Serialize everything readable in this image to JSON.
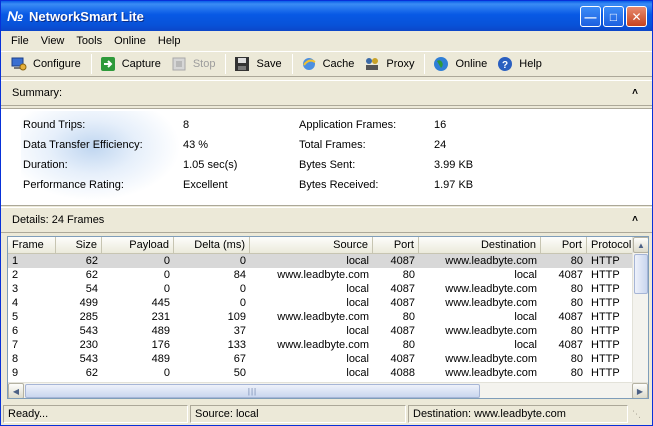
{
  "window": {
    "title": "NetworkSmart Lite"
  },
  "menu": [
    "File",
    "View",
    "Tools",
    "Online",
    "Help"
  ],
  "toolbar": {
    "configure": "Configure",
    "capture": "Capture",
    "stop": "Stop",
    "save": "Save",
    "cache": "Cache",
    "proxy": "Proxy",
    "online": "Online",
    "help": "Help"
  },
  "summary": {
    "header": "Summary:",
    "left": [
      {
        "label": "Round Trips:",
        "value": "8"
      },
      {
        "label": "Data Transfer Efficiency:",
        "value": "43 %"
      },
      {
        "label": "Duration:",
        "value": "1.05 sec(s)"
      },
      {
        "label": "Performance Rating:",
        "value": "Excellent"
      }
    ],
    "right": [
      {
        "label": "Application Frames:",
        "value": "16"
      },
      {
        "label": "Total Frames:",
        "value": "24"
      },
      {
        "label": "Bytes Sent:",
        "value": "3.99 KB"
      },
      {
        "label": "Bytes Received:",
        "value": "1.97 KB"
      }
    ]
  },
  "details": {
    "header": "Details: 24 Frames",
    "columns": [
      "Frame",
      "Size",
      "Payload",
      "Delta (ms)",
      "Source",
      "Port",
      "Destination",
      "Port",
      "Protocol"
    ],
    "rows": [
      [
        "1",
        "62",
        "0",
        "0",
        "local",
        "4087",
        "www.leadbyte.com",
        "80",
        "HTTP"
      ],
      [
        "2",
        "62",
        "0",
        "84",
        "www.leadbyte.com",
        "80",
        "local",
        "4087",
        "HTTP"
      ],
      [
        "3",
        "54",
        "0",
        "0",
        "local",
        "4087",
        "www.leadbyte.com",
        "80",
        "HTTP"
      ],
      [
        "4",
        "499",
        "445",
        "0",
        "local",
        "4087",
        "www.leadbyte.com",
        "80",
        "HTTP"
      ],
      [
        "5",
        "285",
        "231",
        "109",
        "www.leadbyte.com",
        "80",
        "local",
        "4087",
        "HTTP"
      ],
      [
        "6",
        "543",
        "489",
        "37",
        "local",
        "4087",
        "www.leadbyte.com",
        "80",
        "HTTP"
      ],
      [
        "7",
        "230",
        "176",
        "133",
        "www.leadbyte.com",
        "80",
        "local",
        "4087",
        "HTTP"
      ],
      [
        "8",
        "543",
        "489",
        "67",
        "local",
        "4087",
        "www.leadbyte.com",
        "80",
        "HTTP"
      ],
      [
        "9",
        "62",
        "0",
        "50",
        "local",
        "4088",
        "www.leadbyte.com",
        "80",
        "HTTP"
      ]
    ]
  },
  "status": {
    "state": "Ready...",
    "source": "Source: local",
    "destination": "Destination: www.leadbyte.com"
  }
}
